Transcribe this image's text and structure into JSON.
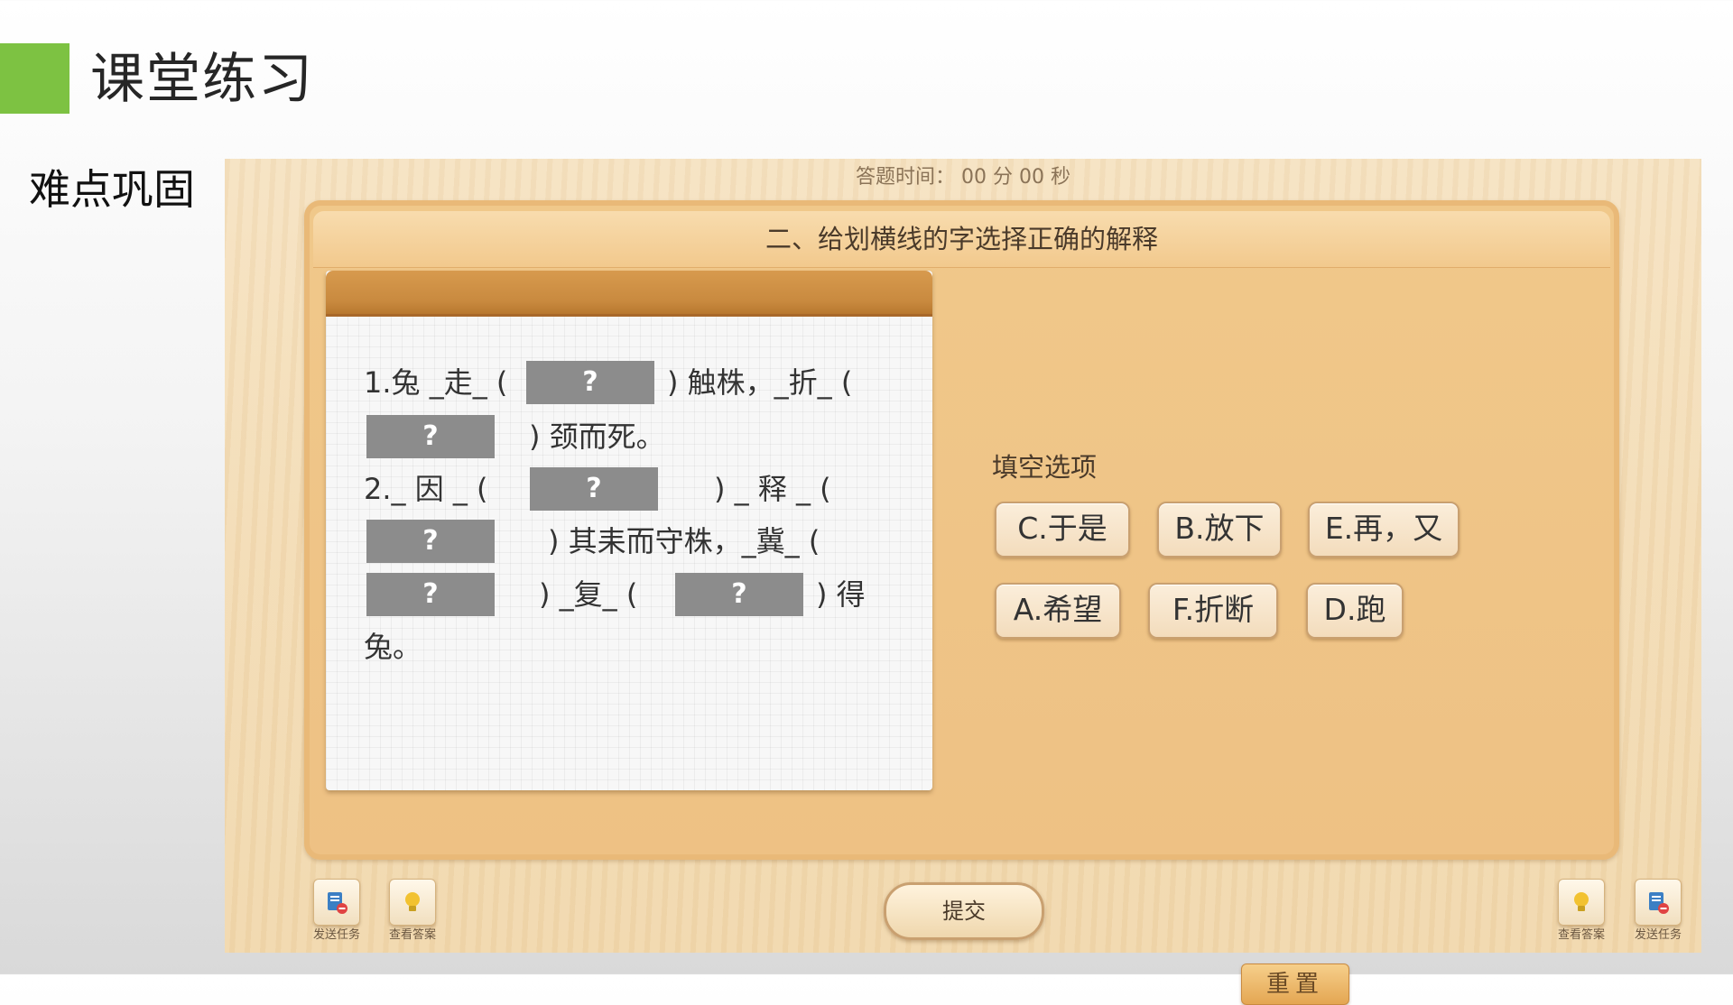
{
  "slide": {
    "title": "课堂练习",
    "section": "难点巩固",
    "accent_color": "#7dc242"
  },
  "app": {
    "timer": "答题时间： 00 分 00 秒",
    "question_title": "二、给划横线的字选择正确的解释",
    "passage": {
      "l1a": "1.兔 _走_ (",
      "l1b": ") 触株，_折_ (",
      "l2a": ") 颈而死。",
      "l3a": "2._ 因 _ (",
      "l3b": ") _ 释 _ (",
      "l4a": ") 其耒而守株，_冀_ (",
      "l5a": ") _复_ (",
      "l5b": ") 得",
      "l6a": "兔。"
    },
    "blank_mark": "?",
    "options_title": "填空选项",
    "options": [
      {
        "label": "C.于是"
      },
      {
        "label": "B.放下"
      },
      {
        "label": "E.再，又"
      },
      {
        "label": "A.希望"
      },
      {
        "label": "F.折断"
      },
      {
        "label": "D.跑"
      }
    ],
    "reset_label": "重置",
    "submit_label": "提交",
    "tools": {
      "left_send": {
        "label": "发送任务",
        "icon": "send-task-icon"
      },
      "left_view": {
        "label": "查看答案",
        "icon": "lightbulb-icon"
      },
      "right_view": {
        "label": "查看答案",
        "icon": "lightbulb-icon"
      },
      "right_send": {
        "label": "发送任务",
        "icon": "send-task-icon"
      }
    }
  }
}
